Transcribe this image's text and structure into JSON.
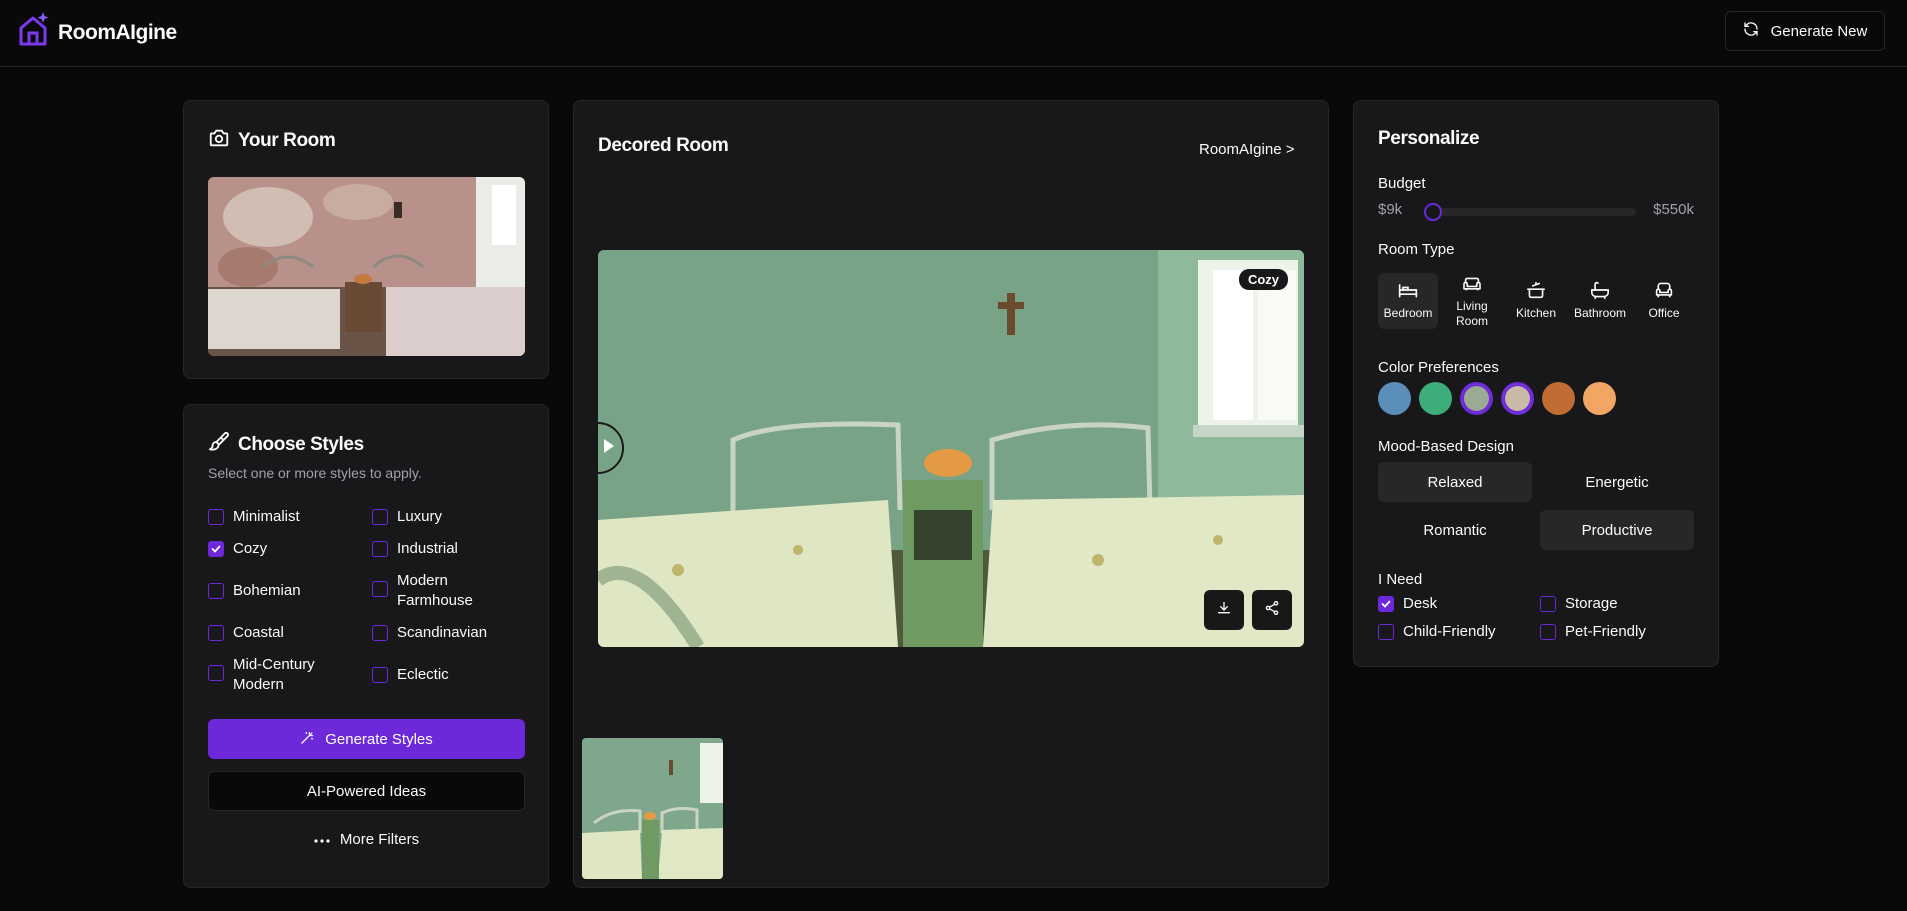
{
  "header": {
    "brand": "RoomAIgine",
    "generate_new": "Generate New"
  },
  "your_room": {
    "title": "Your Room"
  },
  "choose_styles": {
    "title": "Choose Styles",
    "subtitle": "Select one or more styles to apply.",
    "styles": [
      {
        "label": "Minimalist",
        "checked": false
      },
      {
        "label": "Luxury",
        "checked": false
      },
      {
        "label": "Cozy",
        "checked": true
      },
      {
        "label": "Industrial",
        "checked": false
      },
      {
        "label": "Bohemian",
        "checked": false
      },
      {
        "label": "Modern Farmhouse",
        "checked": false
      },
      {
        "label": "Coastal",
        "checked": false
      },
      {
        "label": "Scandinavian",
        "checked": false
      },
      {
        "label": "Mid-Century Modern",
        "checked": false
      },
      {
        "label": "Eclectic",
        "checked": false
      }
    ],
    "generate_button": "Generate Styles",
    "ai_button": "AI-Powered Ideas",
    "more_filters": "More Filters"
  },
  "decored_room": {
    "title": "Decored Room",
    "breadcrumb": "RoomAIgine >",
    "tag": "Cozy"
  },
  "personalize": {
    "title": "Personalize",
    "budget_label": "Budget",
    "budget_min": "$9k",
    "budget_max": "$550k",
    "budget_value_fraction": 0.0,
    "room_type_label": "Room Type",
    "room_types": [
      {
        "label": "Bedroom",
        "icon": "bed-icon",
        "active": true
      },
      {
        "label": "Living Room",
        "icon": "sofa-icon",
        "active": false
      },
      {
        "label": "Kitchen",
        "icon": "cooking-pot-icon",
        "active": false
      },
      {
        "label": "Bathroom",
        "icon": "bath-icon",
        "active": false
      },
      {
        "label": "Office",
        "icon": "armchair-icon",
        "active": false
      }
    ],
    "color_label": "Color Preferences",
    "colors": [
      {
        "hex": "#5b8fb9",
        "selected": false
      },
      {
        "hex": "#3dae7a",
        "selected": false
      },
      {
        "hex": "#9aaa94",
        "selected": true
      },
      {
        "hex": "#cbb9a8",
        "selected": true
      },
      {
        "hex": "#c06d33",
        "selected": false
      },
      {
        "hex": "#f2a664",
        "selected": false
      }
    ],
    "mood_label": "Mood-Based Design",
    "moods": [
      {
        "label": "Relaxed",
        "active": true
      },
      {
        "label": "Energetic",
        "active": false
      },
      {
        "label": "Romantic",
        "active": false
      },
      {
        "label": "Productive",
        "active": true
      }
    ],
    "need_label": "I Need",
    "needs": [
      {
        "label": "Desk",
        "checked": true
      },
      {
        "label": "Storage",
        "checked": false
      },
      {
        "label": "Child-Friendly",
        "checked": false
      },
      {
        "label": "Pet-Friendly",
        "checked": false
      }
    ]
  },
  "colors": {
    "accent": "#6d28d9",
    "background": "#09090b",
    "card": "#18181b",
    "border": "#27272a"
  }
}
